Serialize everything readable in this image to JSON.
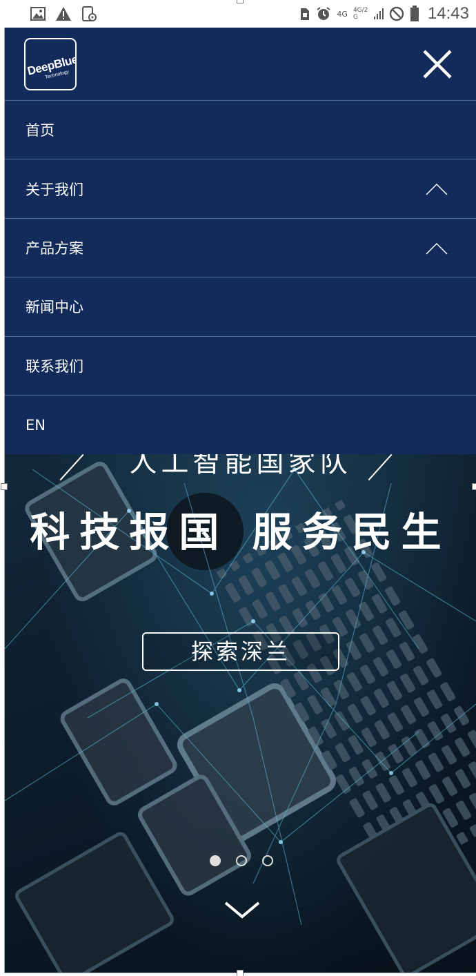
{
  "status_bar": {
    "time": "14:43",
    "network1": "4G",
    "network2": "4G/2G",
    "icons": [
      "image-icon",
      "warning-icon",
      "screenshot-icon",
      "sim-icon",
      "alarm-icon",
      "signal-icon",
      "dnd-icon",
      "battery-icon"
    ]
  },
  "menu": {
    "logo_text": "DeepBlue",
    "logo_subtext": "Technology",
    "close_icon": "close-icon",
    "items": [
      {
        "label": "首页",
        "has_chevron": false
      },
      {
        "label": "关于我们",
        "has_chevron": true
      },
      {
        "label": "产品方案",
        "has_chevron": true
      },
      {
        "label": "新闻中心",
        "has_chevron": false
      },
      {
        "label": "联系我们",
        "has_chevron": false
      },
      {
        "label": "EN",
        "has_chevron": false
      }
    ]
  },
  "hero": {
    "tagline": "人工智能国家队",
    "title": "科技报国  服务民生",
    "cta_label": "探索深兰",
    "slides_total": 3,
    "slide_active": 1,
    "scroll_icon": "chevron-down-icon"
  },
  "colors": {
    "menu_bg": "#122b5b",
    "divider": "#4a6aa0",
    "text": "#ffffff"
  }
}
